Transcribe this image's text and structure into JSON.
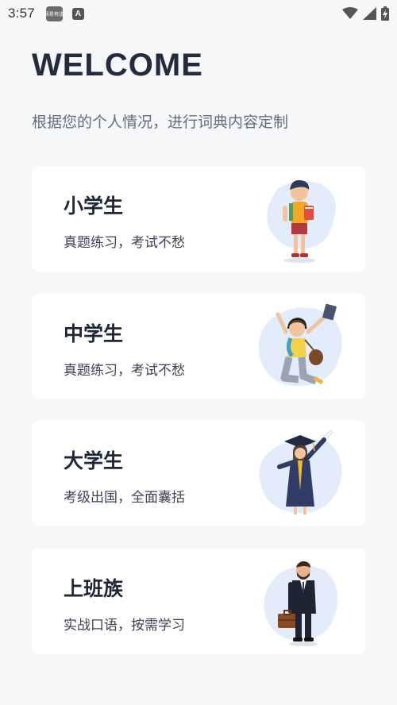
{
  "status_bar": {
    "time": "3:57",
    "app_icon_label": "网易有道",
    "notification_letter": "A",
    "icons": [
      "wifi-icon",
      "signal-icon",
      "battery-charging-icon"
    ]
  },
  "header": {
    "title": "WELCOME",
    "subtitle": "根据您的个人情况，进行词典内容定制"
  },
  "cards": [
    {
      "title": "小学生",
      "desc": "真题练习，考试不愁",
      "illustration": "primary-school-boy"
    },
    {
      "title": "中学生",
      "desc": "真题练习，考试不愁",
      "illustration": "jumping-girl-student"
    },
    {
      "title": "大学生",
      "desc": "考级出国，全面囊括",
      "illustration": "graduate-in-gown"
    },
    {
      "title": "上班族",
      "desc": "实战口语，按需学习",
      "illustration": "businessman-with-briefcase"
    }
  ],
  "colors": {
    "background": "#f6f7f9",
    "card": "#ffffff",
    "title": "#232b3e",
    "blob": "#e3ecfa"
  }
}
